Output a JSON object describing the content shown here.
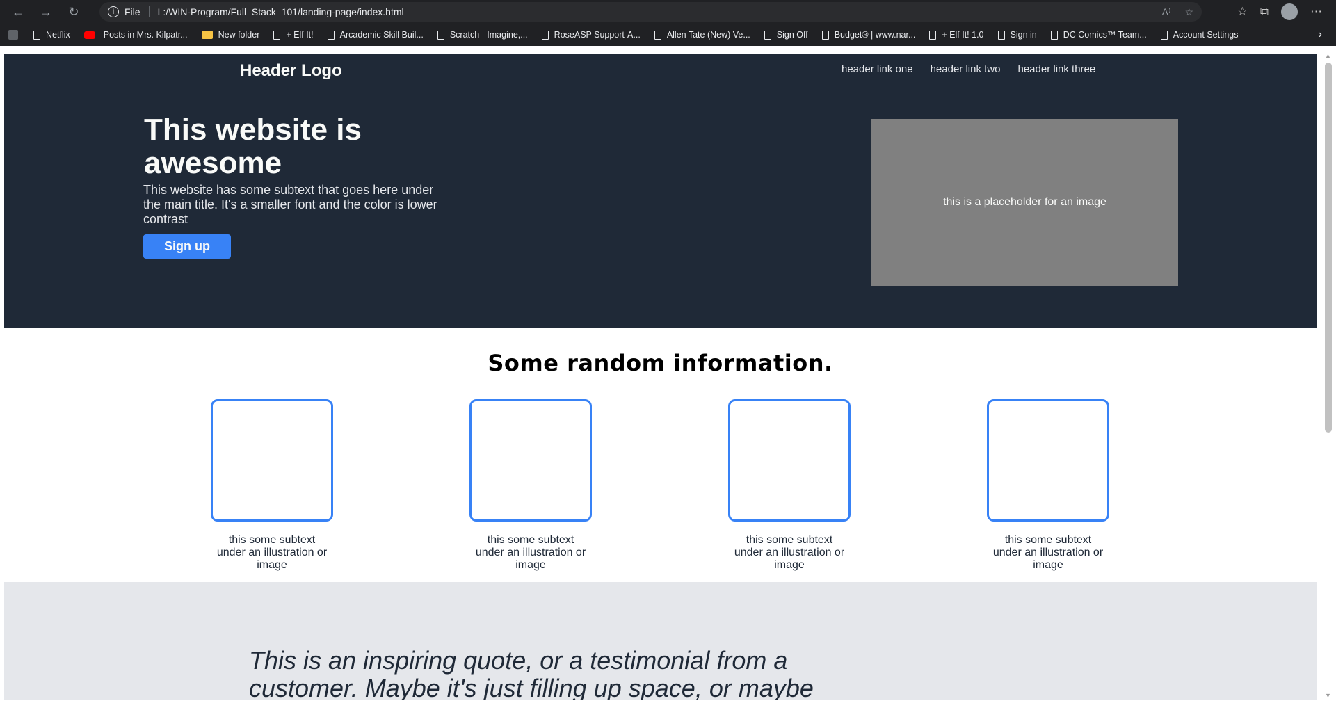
{
  "browser": {
    "scheme_label": "File",
    "url": "L:/WIN-Program/Full_Stack_101/landing-page/index.html",
    "bookmarks": [
      {
        "label": "Netflix",
        "icon": "page-icon"
      },
      {
        "label": "Posts in Mrs. Kilpatr...",
        "icon": "youtube-icon"
      },
      {
        "label": "New folder",
        "icon": "folder-icon"
      },
      {
        "label": "+ Elf It!",
        "icon": "page-icon"
      },
      {
        "label": "Arcademic Skill Buil...",
        "icon": "page-icon"
      },
      {
        "label": "Scratch - Imagine,...",
        "icon": "page-icon"
      },
      {
        "label": "RoseASP Support-A...",
        "icon": "page-icon"
      },
      {
        "label": "Allen Tate (New) Ve...",
        "icon": "page-icon"
      },
      {
        "label": "Sign Off",
        "icon": "page-icon"
      },
      {
        "label": "Budget® | www.nar...",
        "icon": "page-icon"
      },
      {
        "label": "+ Elf It! 1.0",
        "icon": "page-icon"
      },
      {
        "label": "Sign in",
        "icon": "page-icon"
      },
      {
        "label": "DC Comics™ Team...",
        "icon": "page-icon"
      },
      {
        "label": "Account Settings",
        "icon": "page-icon"
      }
    ]
  },
  "header": {
    "logo": "Header Logo",
    "links": [
      "header link one",
      "header link two",
      "header link three"
    ]
  },
  "hero": {
    "title": "This website is awesome",
    "subtext": "This website has some subtext that goes here under the main title. It's a smaller font and the color is lower contrast",
    "button_label": "Sign up",
    "image_placeholder": "this is a placeholder for an image"
  },
  "info": {
    "title": "Some random information.",
    "cards": [
      {
        "text": "this some subtext under an illustration or image"
      },
      {
        "text": "this some subtext under an illustration or image"
      },
      {
        "text": "this some subtext under an illustration or image"
      },
      {
        "text": "this some subtext under an illustration or image"
      }
    ]
  },
  "quote": {
    "text": "This is an inspiring quote, or a testimonial from a customer. Maybe it's just filling up space, or maybe"
  },
  "colors": {
    "hero_bg": "#1f2937",
    "accent": "#3882f6",
    "placeholder_bg": "#808080",
    "quote_bg": "#e5e7eb"
  }
}
